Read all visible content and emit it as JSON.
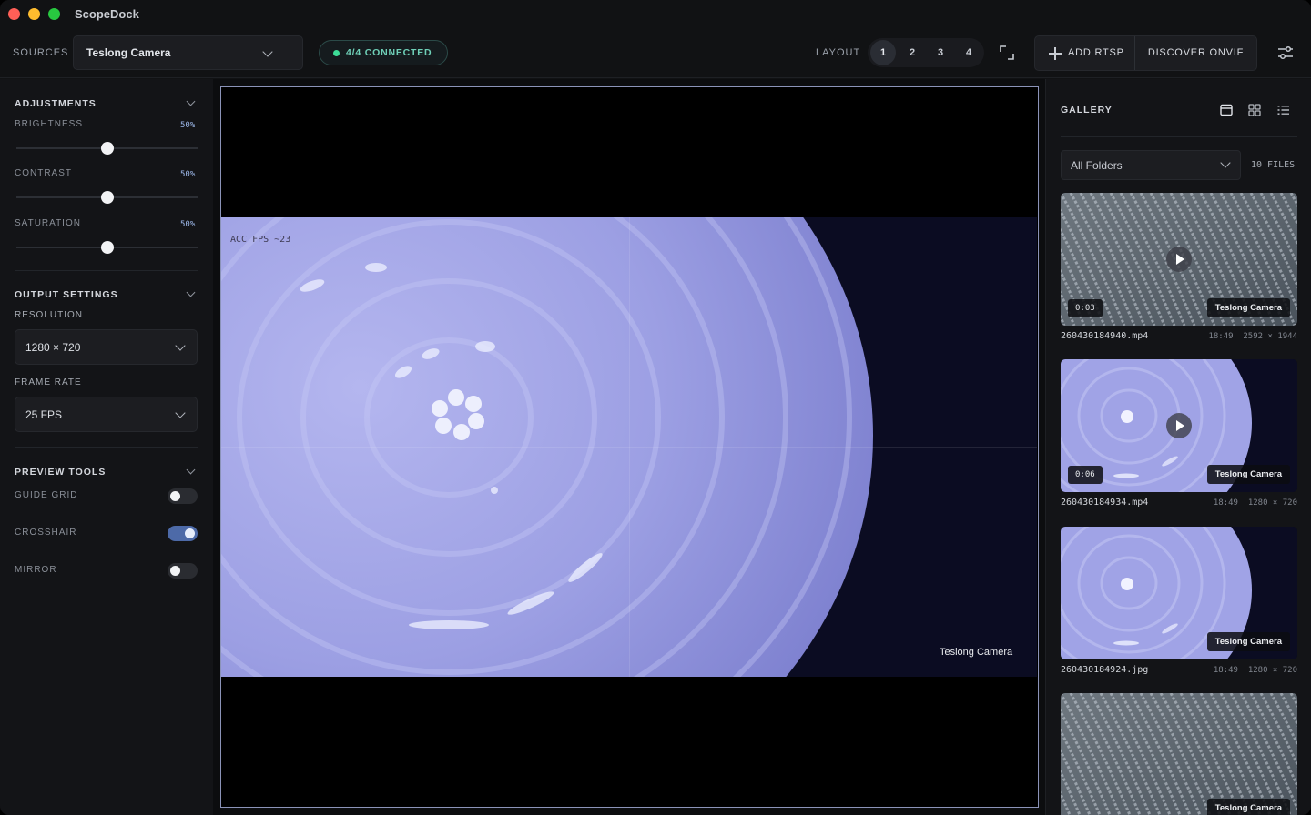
{
  "app": {
    "title": "ScopeDock"
  },
  "toolbar": {
    "sources_label": "SOURCES",
    "source_value": "Teslong Camera",
    "connection_status": "4/4 CONNECTED",
    "layout_label": "LAYOUT",
    "layout_options": [
      "1",
      "2",
      "3",
      "4"
    ],
    "layout_active": "1",
    "add_rtsp_label": "ADD RTSP",
    "discover_onvif_label": "DISCOVER ONVIF"
  },
  "adjustments": {
    "title": "ADJUSTMENTS",
    "sliders": [
      {
        "label": "BRIGHTNESS",
        "value_text": "50%",
        "value": 0.5
      },
      {
        "label": "CONTRAST",
        "value_text": "50%",
        "value": 0.5
      },
      {
        "label": "SATURATION",
        "value_text": "50%",
        "value": 0.5
      }
    ]
  },
  "output_settings": {
    "title": "OUTPUT SETTINGS",
    "resolution_label": "RESOLUTION",
    "resolution_value": "1280 × 720",
    "frame_rate_label": "FRAME RATE",
    "frame_rate_value": "25 FPS"
  },
  "preview_tools": {
    "title": "PREVIEW TOOLS",
    "toggles": [
      {
        "label": "GUIDE GRID",
        "on": false
      },
      {
        "label": "CROSSHAIR",
        "on": true
      },
      {
        "label": "MIRROR",
        "on": false
      }
    ]
  },
  "preview": {
    "camera_label": "Teslong Camera",
    "overlay_text": "ACC  FPS ~23"
  },
  "gallery": {
    "title": "GALLERY",
    "folder_value": "All Folders",
    "files_count": "10 FILES",
    "items": [
      {
        "name": "260430184940.mp4",
        "time": "18:49",
        "dims": "2592 × 1944",
        "duration": "0:03",
        "camera": "Teslong Camera",
        "video": true,
        "style": "texture"
      },
      {
        "name": "260430184934.mp4",
        "time": "18:49",
        "dims": "1280 × 720",
        "duration": "0:06",
        "camera": "Teslong Camera",
        "video": true,
        "style": "ripple"
      },
      {
        "name": "260430184924.jpg",
        "time": "18:49",
        "dims": "1280 × 720",
        "duration": "",
        "camera": "Teslong Camera",
        "video": false,
        "style": "ripple"
      },
      {
        "name": "",
        "time": "",
        "dims": "",
        "duration": "",
        "camera": "Teslong Camera",
        "video": false,
        "style": "texture"
      }
    ]
  },
  "colors": {
    "accent": "#4d6aa8",
    "connected": "#3ddc97",
    "frame_border": "#8b93b8"
  }
}
